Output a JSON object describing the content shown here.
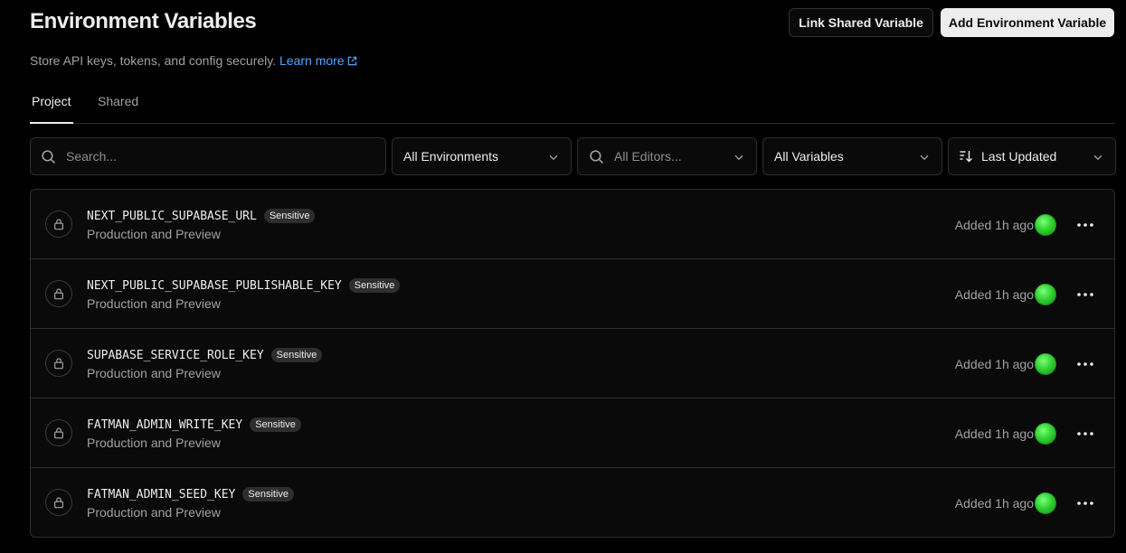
{
  "header": {
    "title": "Environment Variables",
    "subtitle": "Store API keys, tokens, and config securely.",
    "learn_more": "Learn more",
    "link_shared_label": "Link Shared Variable",
    "add_label": "Add Environment Variable"
  },
  "tabs": [
    {
      "label": "Project",
      "active": true
    },
    {
      "label": "Shared",
      "active": false
    }
  ],
  "filters": {
    "search_placeholder": "Search...",
    "environments": "All Environments",
    "editors_placeholder": "All Editors...",
    "variables": "All Variables",
    "sort": "Last Updated"
  },
  "variables": [
    {
      "name": "NEXT_PUBLIC_SUPABASE_URL",
      "badge": "Sensitive",
      "env": "Production and Preview",
      "added": "Added 1h ago"
    },
    {
      "name": "NEXT_PUBLIC_SUPABASE_PUBLISHABLE_KEY",
      "badge": "Sensitive",
      "env": "Production and Preview",
      "added": "Added 1h ago"
    },
    {
      "name": "SUPABASE_SERVICE_ROLE_KEY",
      "badge": "Sensitive",
      "env": "Production and Preview",
      "added": "Added 1h ago"
    },
    {
      "name": "FATMAN_ADMIN_WRITE_KEY",
      "badge": "Sensitive",
      "env": "Production and Preview",
      "added": "Added 1h ago"
    },
    {
      "name": "FATMAN_ADMIN_SEED_KEY",
      "badge": "Sensitive",
      "env": "Production and Preview",
      "added": "Added 1h ago"
    }
  ],
  "icons": {
    "row_icon": "lock-icon",
    "menu_icon": "more-horizontal-icon",
    "search_icon": "search-icon",
    "sort_icon": "sort-icon",
    "chevron_icon": "chevron-down-icon"
  },
  "colors": {
    "background": "#000000",
    "link": "#52a8ff",
    "avatar": "#2fd12f"
  }
}
